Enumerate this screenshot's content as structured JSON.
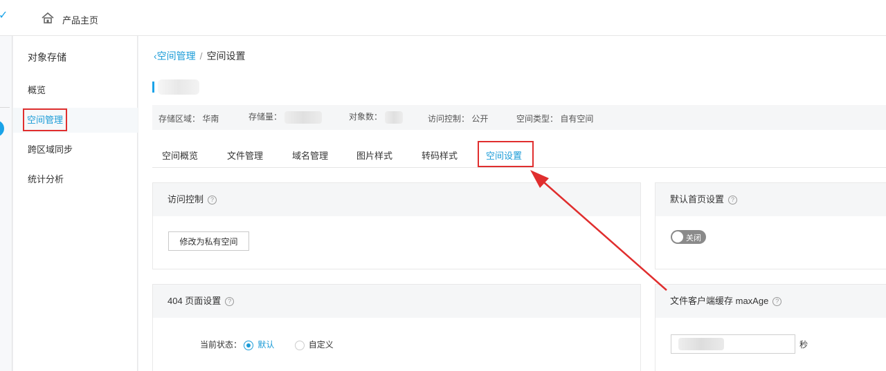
{
  "topbar": {
    "home_label": "产品主页"
  },
  "sidebar": {
    "title": "对象存储",
    "items": [
      {
        "label": "概览"
      },
      {
        "label": "空间管理"
      },
      {
        "label": "跨区域同步"
      },
      {
        "label": "统计分析"
      }
    ]
  },
  "breadcrumb": {
    "back": "空间管理",
    "separator": "/",
    "current": "空间设置"
  },
  "info": {
    "region_label": "存储区域：",
    "region_value": "华南",
    "storage_label": "存储量：",
    "objects_label": "对象数：",
    "access_label": "访问控制：",
    "access_value": "公开",
    "type_label": "空间类型：",
    "type_value": "自有空间"
  },
  "tabs": [
    {
      "label": "空间概览"
    },
    {
      "label": "文件管理"
    },
    {
      "label": "域名管理"
    },
    {
      "label": "图片样式"
    },
    {
      "label": "转码样式"
    },
    {
      "label": "空间设置"
    }
  ],
  "panels": {
    "access": {
      "title": "访问控制",
      "button": "修改为私有空间"
    },
    "homepage": {
      "title": "默认首页设置",
      "switch_label": "关闭"
    },
    "page404": {
      "title": "404 页面设置",
      "status_label": "当前状态：",
      "opt_default": "默认",
      "opt_custom": "自定义"
    },
    "maxage": {
      "title": "文件客户端缓存 maxAge",
      "unit": "秒"
    }
  },
  "help_glyph": "?",
  "colors": {
    "accent": "#1a9bd7",
    "annotation": "#e02e2e"
  }
}
